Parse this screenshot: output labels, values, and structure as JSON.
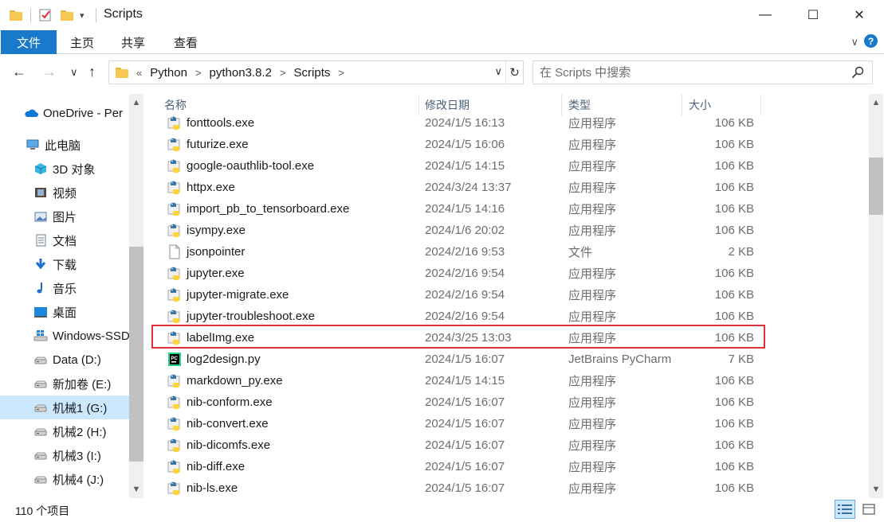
{
  "window": {
    "title": "Scripts",
    "minimize": "—",
    "maximize": "☐",
    "close": "✕"
  },
  "ribbon": {
    "tabs": [
      "文件",
      "主页",
      "共享",
      "查看"
    ],
    "expand": "∨",
    "help": "?"
  },
  "nav": {
    "back": "←",
    "forward": "→",
    "recent": "∨",
    "up": "↑"
  },
  "address": {
    "overflow": "«",
    "crumbs": [
      "Python",
      "python3.8.2",
      "Scripts"
    ],
    "separator": ">",
    "dropdown": "∨",
    "refresh": "↻"
  },
  "search": {
    "placeholder": "在 Scripts 中搜索"
  },
  "sidebar": {
    "items": [
      {
        "label": "OneDrive - Per",
        "icon": "onedrive-icon",
        "selected": false
      },
      {
        "label": "此电脑",
        "icon": "computer-icon",
        "selected": false
      },
      {
        "label": "3D 对象",
        "icon": "3d-objects-icon",
        "selected": false
      },
      {
        "label": "视频",
        "icon": "videos-icon",
        "selected": false
      },
      {
        "label": "图片",
        "icon": "pictures-icon",
        "selected": false
      },
      {
        "label": "文档",
        "icon": "documents-icon",
        "selected": false
      },
      {
        "label": "下载",
        "icon": "downloads-icon",
        "selected": false
      },
      {
        "label": "音乐",
        "icon": "music-icon",
        "selected": false
      },
      {
        "label": "桌面",
        "icon": "desktop-icon",
        "selected": false
      },
      {
        "label": "Windows-SSD",
        "icon": "windows-drive-icon",
        "selected": false
      },
      {
        "label": "Data (D:)",
        "icon": "drive-icon",
        "selected": false
      },
      {
        "label": "新加卷 (E:)",
        "icon": "drive-icon",
        "selected": false
      },
      {
        "label": "机械1 (G:)",
        "icon": "drive-icon",
        "selected": true
      },
      {
        "label": "机械2 (H:)",
        "icon": "drive-icon",
        "selected": false
      },
      {
        "label": "机械3 (I:)",
        "icon": "drive-icon",
        "selected": false
      },
      {
        "label": "机械4 (J:)",
        "icon": "drive-icon",
        "selected": false
      }
    ]
  },
  "columns": {
    "name": "名称",
    "modified": "修改日期",
    "type": "类型",
    "size": "大小",
    "sort_indicator": "^"
  },
  "files": [
    {
      "name": "fonttools.exe",
      "modified": "2024/1/5 16:13",
      "type": "应用程序",
      "size": "106 KB",
      "icon": "python-exe-icon"
    },
    {
      "name": "futurize.exe",
      "modified": "2024/1/5 16:06",
      "type": "应用程序",
      "size": "106 KB",
      "icon": "python-exe-icon"
    },
    {
      "name": "google-oauthlib-tool.exe",
      "modified": "2024/1/5 14:15",
      "type": "应用程序",
      "size": "106 KB",
      "icon": "python-exe-icon"
    },
    {
      "name": "httpx.exe",
      "modified": "2024/3/24 13:37",
      "type": "应用程序",
      "size": "106 KB",
      "icon": "python-exe-icon"
    },
    {
      "name": "import_pb_to_tensorboard.exe",
      "modified": "2024/1/5 14:16",
      "type": "应用程序",
      "size": "106 KB",
      "icon": "python-exe-icon"
    },
    {
      "name": "isympy.exe",
      "modified": "2024/1/6 20:02",
      "type": "应用程序",
      "size": "106 KB",
      "icon": "python-exe-icon"
    },
    {
      "name": "jsonpointer",
      "modified": "2024/2/16 9:53",
      "type": "文件",
      "size": "2 KB",
      "icon": "blank-file-icon"
    },
    {
      "name": "jupyter.exe",
      "modified": "2024/2/16 9:54",
      "type": "应用程序",
      "size": "106 KB",
      "icon": "python-exe-icon"
    },
    {
      "name": "jupyter-migrate.exe",
      "modified": "2024/2/16 9:54",
      "type": "应用程序",
      "size": "106 KB",
      "icon": "python-exe-icon"
    },
    {
      "name": "jupyter-troubleshoot.exe",
      "modified": "2024/2/16 9:54",
      "type": "应用程序",
      "size": "106 KB",
      "icon": "python-exe-icon"
    },
    {
      "name": "labelImg.exe",
      "modified": "2024/3/25 13:03",
      "type": "应用程序",
      "size": "106 KB",
      "icon": "python-exe-icon",
      "highlighted": true
    },
    {
      "name": "log2design.py",
      "modified": "2024/1/5 16:07",
      "type": "JetBrains PyCharm",
      "size": "7 KB",
      "icon": "pycharm-file-icon"
    },
    {
      "name": "markdown_py.exe",
      "modified": "2024/1/5 14:15",
      "type": "应用程序",
      "size": "106 KB",
      "icon": "python-exe-icon"
    },
    {
      "name": "nib-conform.exe",
      "modified": "2024/1/5 16:07",
      "type": "应用程序",
      "size": "106 KB",
      "icon": "python-exe-icon"
    },
    {
      "name": "nib-convert.exe",
      "modified": "2024/1/5 16:07",
      "type": "应用程序",
      "size": "106 KB",
      "icon": "python-exe-icon"
    },
    {
      "name": "nib-dicomfs.exe",
      "modified": "2024/1/5 16:07",
      "type": "应用程序",
      "size": "106 KB",
      "icon": "python-exe-icon"
    },
    {
      "name": "nib-diff.exe",
      "modified": "2024/1/5 16:07",
      "type": "应用程序",
      "size": "106 KB",
      "icon": "python-exe-icon"
    },
    {
      "name": "nib-ls.exe",
      "modified": "2024/1/5 16:07",
      "type": "应用程序",
      "size": "106 KB",
      "icon": "python-exe-icon"
    }
  ],
  "status": {
    "item_count": "110 个项目"
  },
  "colors": {
    "accent": "#1979ca",
    "selection": "#cce8ff",
    "highlight_border": "#e0303a",
    "header_text": "#4c607a"
  }
}
